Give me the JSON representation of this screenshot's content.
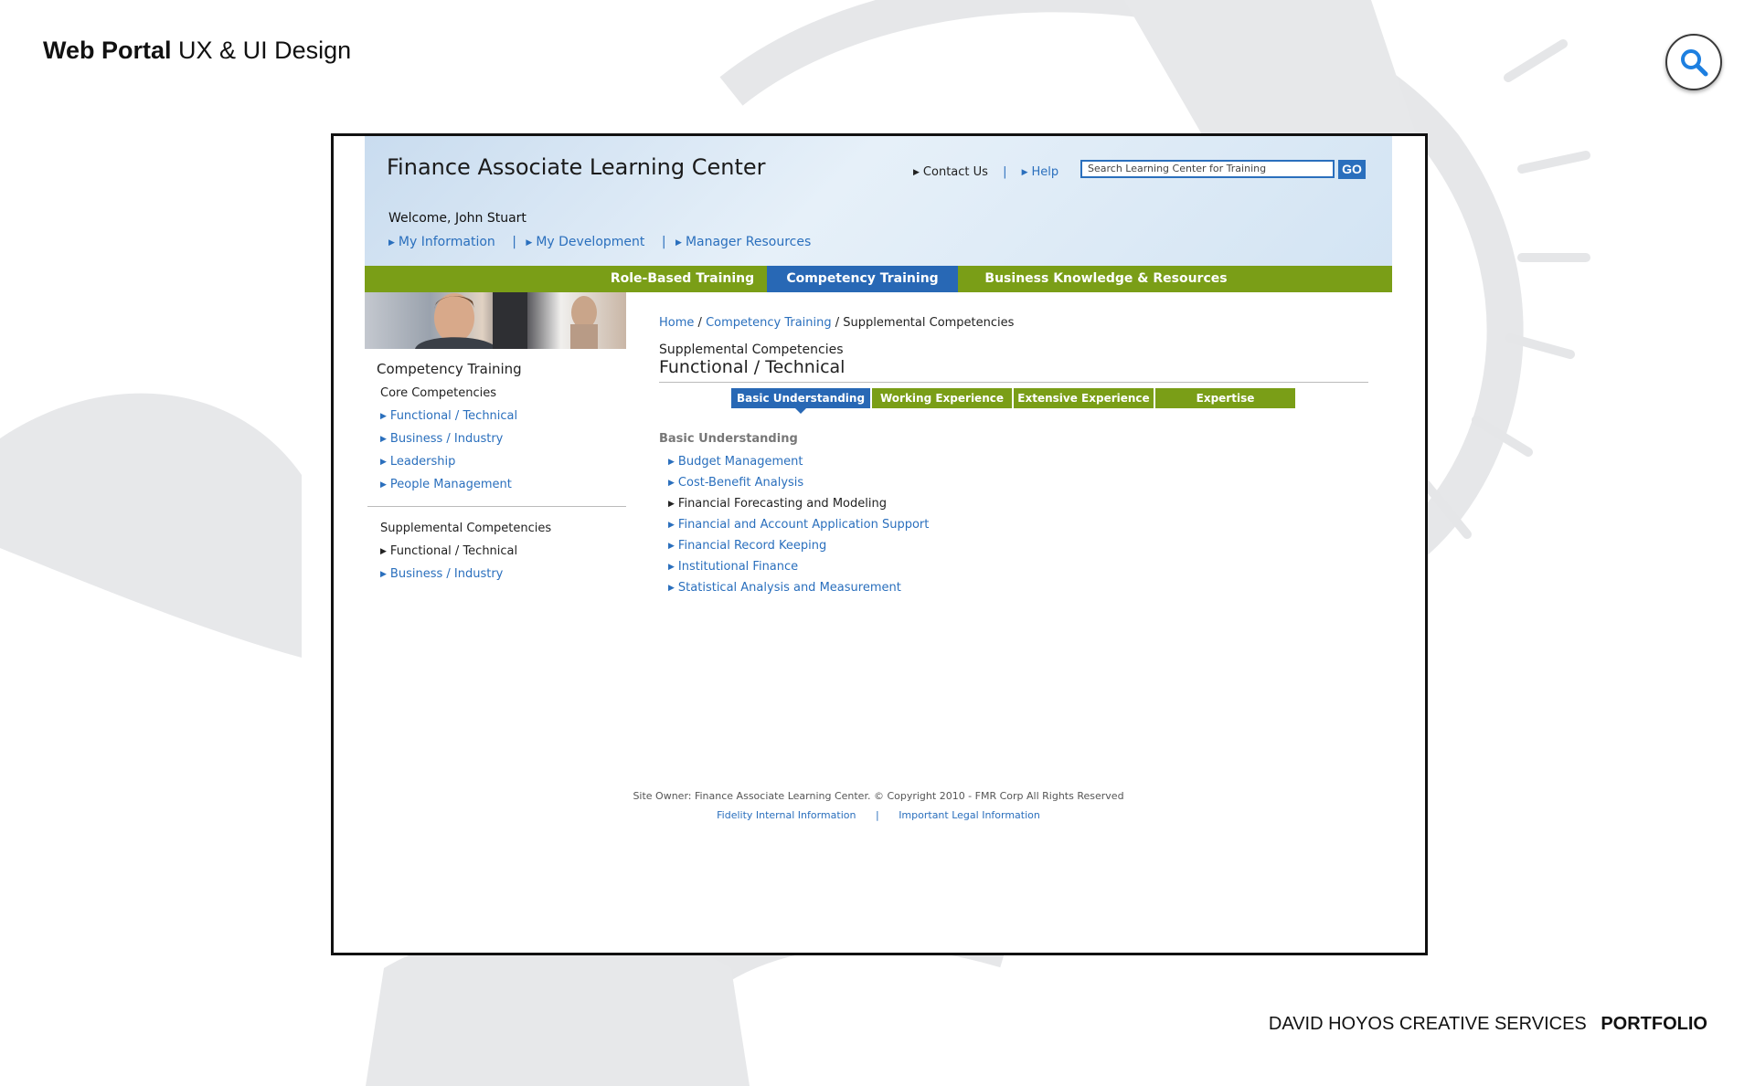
{
  "portfolio": {
    "title_bold": "Web Portal",
    "title_rest": "UX & UI Design",
    "footer_brand": "DAVID HOYOS CREATIVE SERVICES",
    "footer_portfolio": "PORTFOLIO"
  },
  "site": {
    "title": "Finance Associate Learning Center",
    "util_links": {
      "contact": "Contact Us",
      "help": "Help"
    },
    "search": {
      "placeholder": "Search Learning Center for Training",
      "button": "GO"
    },
    "welcome": "Welcome, John Stuart",
    "personal_nav": [
      "My Information",
      "My Development",
      "Manager Resources"
    ],
    "main_nav": [
      {
        "label": "Role-Based Training",
        "active": false
      },
      {
        "label": "Competency Training",
        "active": true
      },
      {
        "label": "Business Knowledge & Resources",
        "active": false
      }
    ],
    "sidebar": {
      "heading": "Competency Training",
      "core_heading": "Core Competencies",
      "core_items": [
        "Functional / Technical",
        "Business / Industry",
        "Leadership",
        "People Management"
      ],
      "supp_heading": "Supplemental Competencies",
      "supp_items": [
        "Functional / Technical",
        "Business / Industry"
      ],
      "supp_current": "Functional / Technical"
    },
    "breadcrumb": {
      "home": "Home",
      "sep1": "/",
      "section": "Competency Training",
      "sep2": "/",
      "current": "Supplemental Competencies"
    },
    "section_sub": "Supplemental Competencies",
    "section_title": "Functional / Technical",
    "level_tabs": [
      "Basic Understanding",
      "Working Experience",
      "Extensive Experience",
      "Expertise"
    ],
    "active_level": "Basic Understanding",
    "level_heading": "Basic Understanding",
    "topics": [
      "Budget Management",
      "Cost-Benefit Analysis",
      "Financial Forecasting and Modeling",
      "Financial and Account Application Support",
      "Financial Record Keeping",
      "Institutional Finance",
      "Statistical Analysis and Measurement"
    ],
    "topic_current": "Financial Forecasting and Modeling",
    "footer": {
      "owner": "Site Owner: Finance Associate Learning Center. © Copyright 2010 - FMR Corp All Rights Reserved",
      "link1": "Fidelity Internal Information",
      "link2": "Important Legal Information"
    }
  },
  "colors": {
    "nav_green": "#7a9e17",
    "nav_blue": "#2868b5",
    "link_blue": "#2a6fbd"
  },
  "icons": [
    "search-icon",
    "triangle-bullet-icon"
  ]
}
